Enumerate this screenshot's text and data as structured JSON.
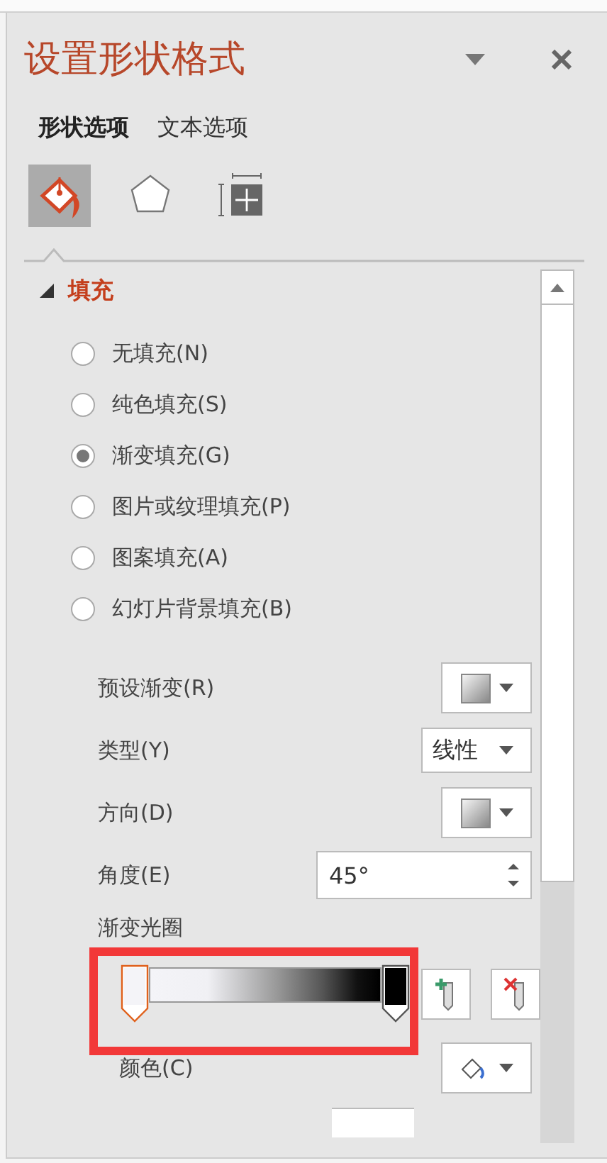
{
  "panel": {
    "title": "设置形状格式"
  },
  "tabs": [
    {
      "label": "形状选项",
      "selected": true
    },
    {
      "label": "文本选项",
      "selected": false
    }
  ],
  "icon_tabs": [
    {
      "kind": "fill",
      "selected": true
    },
    {
      "kind": "shape",
      "selected": false
    },
    {
      "kind": "size",
      "selected": false
    }
  ],
  "section": {
    "title": "填充",
    "expanded": true
  },
  "fill_options": [
    {
      "label": "无填充(N)",
      "selected": false
    },
    {
      "label": "纯色填充(S)",
      "selected": false
    },
    {
      "label": "渐变填充(G)",
      "selected": true
    },
    {
      "label": "图片或纹理填充(P)",
      "selected": false
    },
    {
      "label": "图案填充(A)",
      "selected": false
    },
    {
      "label": "幻灯片背景填充(B)",
      "selected": false
    }
  ],
  "settings": [
    {
      "label": "预设渐变(R)",
      "kind": "swatch"
    },
    {
      "label": "类型(Y)",
      "kind": "text",
      "value": "线性"
    },
    {
      "label": "方向(D)",
      "kind": "swatch"
    },
    {
      "label": "角度(E)",
      "kind": "spinner",
      "value": "45°"
    }
  ],
  "gradient_stops": {
    "label": "渐变光圈",
    "stops": [
      {
        "selected": true,
        "color": "#f4f4f8"
      },
      {
        "selected": false,
        "color": "#000000"
      }
    ]
  },
  "color": {
    "label": "颜色(C)"
  }
}
